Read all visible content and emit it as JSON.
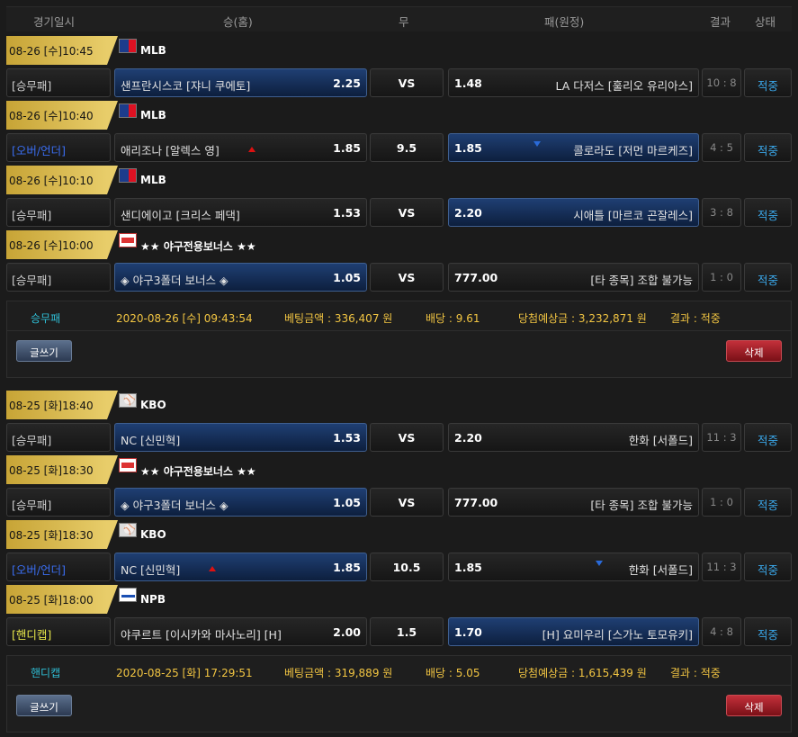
{
  "header": {
    "date": "경기일시",
    "home": "승(홈)",
    "draw": "무",
    "away": "패(원정)",
    "result": "결과",
    "status": "상태"
  },
  "slips": [
    {
      "matches": [
        {
          "date": "08-26 [수]10:45",
          "league": "MLB",
          "logo": "mlb-logo",
          "type": "[승무패]",
          "type_color": "normal",
          "home": "샌프란시스코 [쟈니 쿠에토]",
          "home_odd": "2.25",
          "mid": "VS",
          "away": "LA 다저스 [훌리오 유리아스]",
          "away_odd": "1.48",
          "selected": "home",
          "score": "10 : 8",
          "status": "적중",
          "arrow": ""
        },
        {
          "date": "08-26 [수]10:40",
          "league": "MLB",
          "logo": "mlb-logo",
          "type": "[오버/언더]",
          "type_color": "blue",
          "home": "애리조나 [알렉스 영]",
          "home_odd": "1.85",
          "mid": "9.5",
          "away": "콜로라도 [저먼 마르케즈]",
          "away_odd": "1.85",
          "selected": "away",
          "score": "4 : 5",
          "status": "적중",
          "arrow": "both"
        },
        {
          "date": "08-26 [수]10:10",
          "league": "MLB",
          "logo": "mlb-logo",
          "type": "[승무패]",
          "type_color": "normal",
          "home": "샌디에이고 [크리스 페댁]",
          "home_odd": "1.53",
          "mid": "VS",
          "away": "시애틀 [마르코 곤잘레스]",
          "away_odd": "2.20",
          "selected": "away",
          "score": "3 : 8",
          "status": "적중",
          "arrow": ""
        },
        {
          "date": "08-26 [수]10:00",
          "league": "★★ 야구전용보너스 ★★",
          "logo": "bonus-logo",
          "type": "[승무패]",
          "type_color": "normal",
          "home": "◈ 야구3폴더 보너스 ◈",
          "home_odd": "1.05",
          "mid": "VS",
          "away": "[타 종목] 조합 불가능",
          "away_odd": "777.00",
          "selected": "home",
          "score": "1 : 0",
          "status": "적중",
          "arrow": ""
        }
      ],
      "summary": {
        "type": "승무패",
        "date": "2020-08-26 [수] 09:43:54",
        "bet": "베팅금액 : 336,407 원",
        "odds": "배당 : 9.61",
        "win": "당첨예상금 : 3,232,871 원",
        "result": "결과 : 적중"
      },
      "write_label": "글쓰기",
      "delete_label": "삭제"
    },
    {
      "matches": [
        {
          "date": "08-25 [화]18:40",
          "league": "KBO",
          "logo": "kbo-logo",
          "type": "[승무패]",
          "type_color": "normal",
          "home": "NC [신민혁]",
          "home_odd": "1.53",
          "mid": "VS",
          "away": "한화 [서폴드]",
          "away_odd": "2.20",
          "selected": "home",
          "score": "11 : 3",
          "status": "적중",
          "arrow": ""
        },
        {
          "date": "08-25 [화]18:30",
          "league": "★★ 야구전용보너스 ★★",
          "logo": "bonus-logo",
          "type": "[승무패]",
          "type_color": "normal",
          "home": "◈ 야구3폴더 보너스 ◈",
          "home_odd": "1.05",
          "mid": "VS",
          "away": "[타 종목] 조합 불가능",
          "away_odd": "777.00",
          "selected": "home",
          "score": "1 : 0",
          "status": "적중",
          "arrow": ""
        },
        {
          "date": "08-25 [화]18:30",
          "league": "KBO",
          "logo": "kbo-logo",
          "type": "[오버/언더]",
          "type_color": "blue",
          "home": "NC [신민혁]",
          "home_odd": "1.85",
          "mid": "10.5",
          "away": "한화 [서폴드]",
          "away_odd": "1.85",
          "selected": "home",
          "score": "11 : 3",
          "status": "적중",
          "arrow": "both"
        },
        {
          "date": "08-25 [화]18:00",
          "league": "NPB",
          "logo": "npb-logo",
          "type": "[핸디캡]",
          "type_color": "yellow",
          "home": "야쿠르트 [이시카와 마사노리] [H]",
          "home_odd": "2.00",
          "mid": "1.5",
          "away": "[H] 요미우리 [스가노 토모유키]",
          "away_odd": "1.70",
          "selected": "away",
          "score": "4 : 8",
          "status": "적중",
          "arrow": ""
        }
      ],
      "summary": {
        "type": "핸디캡",
        "date": "2020-08-25 [화] 17:29:51",
        "bet": "베팅금액 : 319,889 원",
        "odds": "배당 : 5.05",
        "win": "당첨예상금 : 1,615,439 원",
        "result": "결과 : 적중"
      },
      "write_label": "글쓰기",
      "delete_label": "삭제"
    }
  ]
}
